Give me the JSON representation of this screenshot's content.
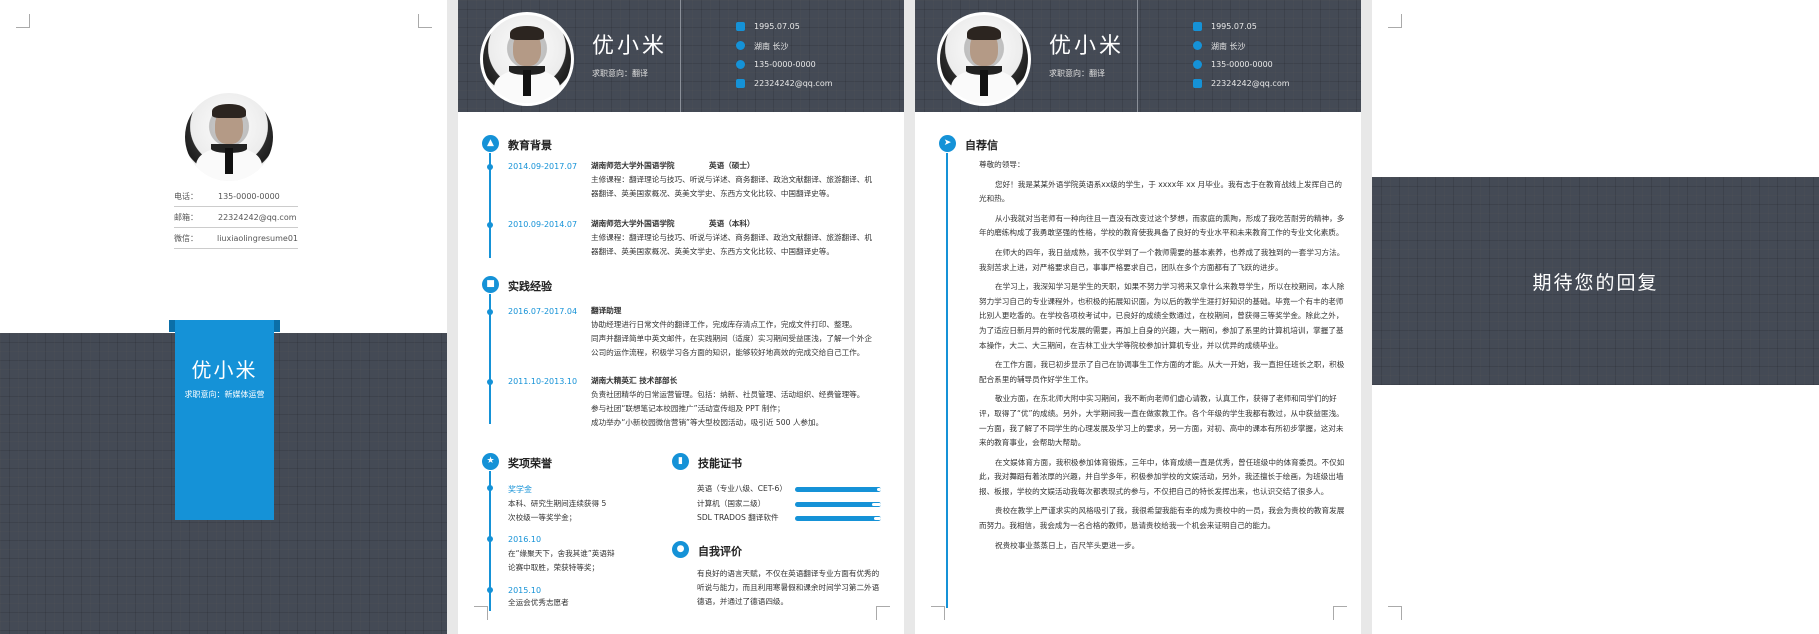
{
  "cover": {
    "contacts": [
      {
        "label": "电话：",
        "value": "135-0000-0000"
      },
      {
        "label": "邮箱：",
        "value": "22324242@qq.com"
      },
      {
        "label": "微信：",
        "value": "liuxiaolingresume01"
      }
    ],
    "name": "优小米",
    "job": "求职意向：新媒体运营"
  },
  "header": {
    "name": "优小米",
    "job": "求职意向：翻译",
    "birthday": "1995.07.05",
    "location": "湖南 长沙",
    "phone": "135-0000-0000",
    "email": "22324242@qq.com"
  },
  "resume": {
    "education": {
      "title": "教育背景",
      "items": [
        {
          "date": "2014.09-2017.07",
          "school": "湖南师范大学外国语学院",
          "degree": "英语（硕士）",
          "line1": "主修课程：翻译理论与技巧、听说与详述、商务翻译、政治文献翻译、旅游翻译、机",
          "line2": "器翻译、英美国家概况、英美文学史、东西方文化比较、中国翻译史等。"
        },
        {
          "date": "2010.09-2014.07",
          "school": "湖南师范大学外国语学院",
          "degree": "英语（本科）",
          "line1": "主修课程：翻译理论与技巧、听说与详述、商务翻译、政治文献翻译、旅游翻译、机",
          "line2": "器翻译、英美国家概况、英美文学史、东西方文化比较、中国翻译史等。"
        }
      ]
    },
    "experience": {
      "title": "实践经验",
      "items": [
        {
          "date": "2016.07-2017.04",
          "role": "翻译助理",
          "lines": [
            "协助经理进行日常文件的翻译工作，完成库存清点工作，完成文件打印、整理。",
            "同声并翻译简单中英文邮件，在实践期间（适度）实习期间受益匪浅，了解一个外企",
            "公司的运作流程，积极学习各方面的知识，能够较好地高效的完成交给自己工作。"
          ]
        },
        {
          "date": "2011.10-2013.10",
          "role": "湖南大精英汇 技术部部长",
          "lines": [
            "负责社团精华的日常运营管理。包括：纳新、社员管理、活动组织、经费管理等。",
            "参与社团“联想笔记本校园推广”活动宣传组及 PPT 制作；",
            "成功举办“小新校园微信营销”等大型校园活动，吸引近 500 人参加。"
          ]
        }
      ]
    },
    "awards": {
      "title": "奖项荣誉",
      "items": [
        {
          "date": "奖学金",
          "lines": [
            "本科、研究生期间连续获得 5",
            "次校级一等奖学金；"
          ]
        },
        {
          "date": "2016.10",
          "lines": [
            "在“缘聚天下，舍我其谁”英语辩",
            "论赛中取胜，荣获特等奖；"
          ]
        },
        {
          "date": "2015.10",
          "lines": [
            "全运会优秀志愿者"
          ]
        }
      ]
    },
    "skills": {
      "title": "技能证书",
      "items": [
        {
          "label": "英语（专业八级、CET-6）",
          "level": 0.95
        },
        {
          "label": "计算机（国家二级）",
          "level": 0.9
        },
        {
          "label": "SDL TRADOS 翻译软件",
          "level": 0.92
        }
      ]
    },
    "self": {
      "title": "自我评价",
      "lines": [
        "有良好的语言天赋，不仅在英语翻译专业方面有优秀的",
        "听说与能力，而且利用寒暑假和课余时间学习第二外语",
        "德语，并通过了德语四级。"
      ]
    }
  },
  "letter": {
    "title": "自荐信",
    "greeting": "尊敬的领导：",
    "paragraphs": [
      "您好！我是某某外语学院英语系xx级的学生，于 xxxx年 xx 月毕业。我有志于在教育战线上发挥自己的光和热。",
      "从小我就对当老师有一种向往且一直没有改变过这个梦想，而家庭的熏陶，形成了我吃苦耐劳的精神，多年的磨练构成了我勇敢坚强的性格，学校的教育使我具备了良好的专业水平和未来教育工作的专业文化素质。",
      "在师大的四年，我日益成熟，我不仅学到了一个教师需要的基本素养，也养成了我独到的一套学习方法。我刻苦求上进，对严格要求自己，事事严格要求自己，团队在多个方面都有了飞跃的进步。",
      "在学习上，我深知学习是学生的天职，如果不努力学习将来又拿什么来教导学生，所以在校期间，本人除努力学习自己的专业课程外，也积极的拓展知识面，为以后的教学生涯打好知识的基础。毕竟一个有丰的老师比别人更吃香的。在学校各项校考试中，已良好的成绩全数通过，在校期间，曾获得三等奖学金。除此之外，为了适应日新月异的新时代发展的需要，再加上自身的兴趣，大一期间，参加了系里的计算机培训，掌握了基本操作，大二、大三期间，在吉林工业大学等院校参加计算机专业，并以优异的成绩毕业。",
      "在工作方面，我已初步显示了自己在协调事生工作方面的才能。从大一开始，我一直担任班长之职，积极配合系里的辅导员作好学生工作。",
      "敬业方面，在东北师大附中实习期间，我不断向老师们虚心请教，认真工作，获得了老师和同学们的好评，取得了“优”的成绩。另外，大学期间我一直在做家教工作。各个年级的学生我都有教过，从中获益匪浅。一方面，我了解了不同学生的心理发展及学习上的要求，另一方面，对初、高中的课本有所初步掌握，这对未来的教育事业，会帮助大帮助。",
      "在文娱体育方面，我积极参加体育锻炼，三年中，体育成绩一直是优秀，曾任班级中的体育委员。不仅如此，我对舞蹈有着浓厚的兴趣，并自学多年，积极参加学校的文娱活动，另外，我还擅长于绘画，为班级出墙报、板报，学校的文娱活动我每次都表现式的参与，不仅把自己的特长发挥出来，也认识交结了很多人。",
      "贵校在教学上严谨求实的风格吸引了我，我很希望我能有幸的成为贵校中的一员，我会为贵校的教育发展而努力。我相信，我会成为一名合格的教师，恳请贵校给我一个机会来证明自己的能力。",
      "祝贵校事业蒸蒸日上，百尺竿头更进一步。"
    ]
  },
  "back": {
    "message": "期待您的回复"
  },
  "colors": {
    "accent": "#1592d7",
    "dark": "#444a55"
  }
}
